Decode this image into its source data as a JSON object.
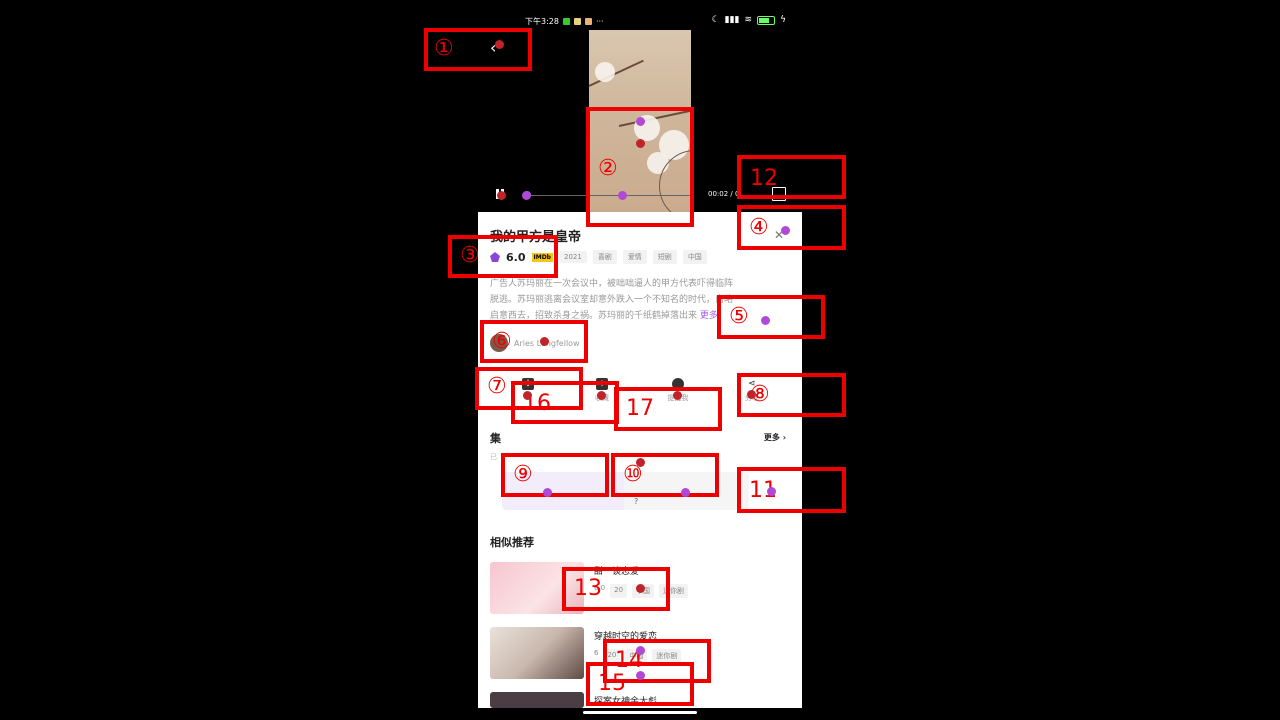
{
  "status_bar": {
    "time": "下午3:28",
    "dots": "···"
  },
  "video": {
    "time": "00:02 / 0"
  },
  "show": {
    "title": "我的甲方是皇帝",
    "score": "6.0",
    "imdb": "IMDb",
    "tags": [
      "2021",
      "喜剧",
      "爱情",
      "短剧",
      "中国"
    ],
    "description_lines": [
      "广告人苏玛丽在一次会议中，被咄咄逼人的甲方代表吓得临阵",
      "脱逃。苏玛丽逃离会议室却意外跌入一个不知名的时代，自略",
      "启意西去，招致杀身之祸。苏玛丽的千纸鹤掉落出来"
    ],
    "more_label": "更多",
    "actor": "Aries Longfellow"
  },
  "actions": {
    "download": "",
    "favorite": "收藏",
    "remind": "提醒我",
    "share": "分享"
  },
  "episodes": {
    "title": "集",
    "more_label": "更多",
    "note": "已",
    "items": [
      "",
      "?"
    ]
  },
  "similar": {
    "title": "相似推荐",
    "items": [
      {
        "title": "甜一谈恋爱",
        "meta": [
          "6.0",
          "20",
          "中国",
          "迷你剧"
        ]
      },
      {
        "title": "穿越时空的爱恋",
        "meta": [
          "6",
          "20",
          "中国",
          "迷你剧"
        ]
      },
      {
        "title": "探案女神余大彪",
        "meta": []
      }
    ]
  },
  "annotations": {
    "labels": [
      "①",
      "②",
      "③",
      "④",
      "⑤",
      "⑥",
      "⑦",
      "⑧",
      "⑨",
      "⑩",
      "11",
      "12",
      "13",
      "14",
      "15",
      "16",
      "17"
    ]
  }
}
